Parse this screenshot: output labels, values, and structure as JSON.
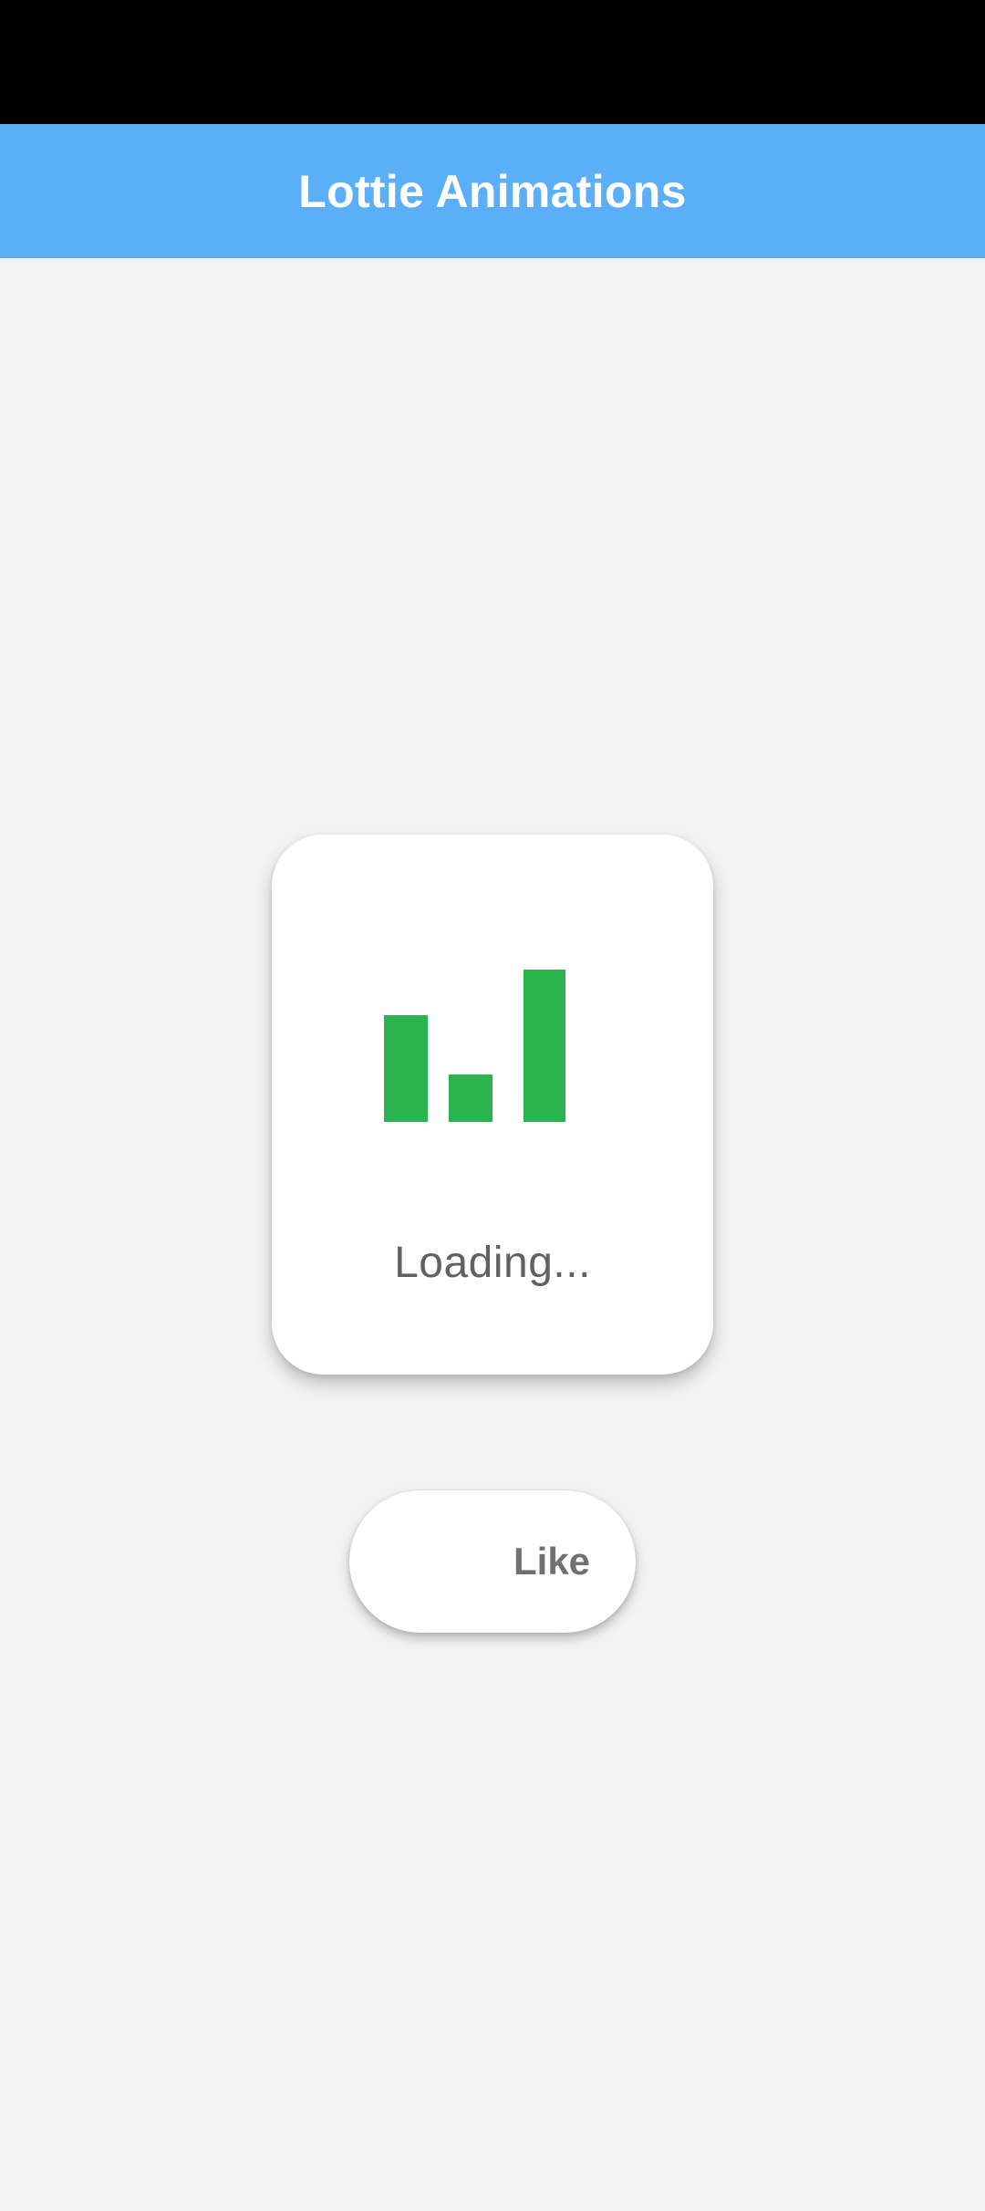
{
  "app": {
    "title": "Lottie Animations"
  },
  "loading_card": {
    "text": "Loading...",
    "animation_icon": "bar-chart-loading-icon"
  },
  "like_button": {
    "label": "Like",
    "icon": "heart-icon"
  },
  "colors": {
    "status_bar": "#000000",
    "app_bar": "#5aaff8",
    "background": "#f3f3f3",
    "card": "#ffffff",
    "loader_bars": "#2bb350",
    "loading_text": "#616161",
    "like_text": "#707070"
  }
}
